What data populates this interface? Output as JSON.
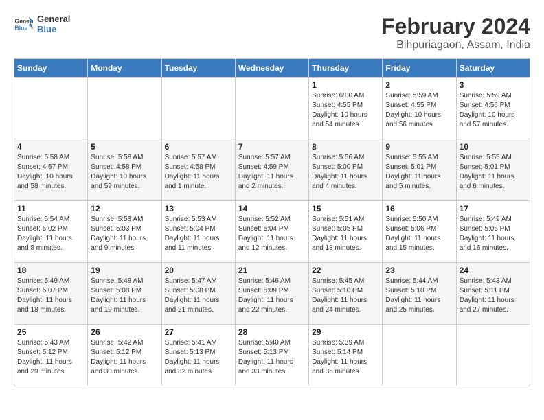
{
  "header": {
    "logo_line1": "General",
    "logo_line2": "Blue",
    "title": "February 2024",
    "subtitle": "Bihpuriagaon, Assam, India"
  },
  "days_of_week": [
    "Sunday",
    "Monday",
    "Tuesday",
    "Wednesday",
    "Thursday",
    "Friday",
    "Saturday"
  ],
  "weeks": [
    [
      {
        "day": "",
        "sunrise": "",
        "sunset": "",
        "daylight": ""
      },
      {
        "day": "",
        "sunrise": "",
        "sunset": "",
        "daylight": ""
      },
      {
        "day": "",
        "sunrise": "",
        "sunset": "",
        "daylight": ""
      },
      {
        "day": "",
        "sunrise": "",
        "sunset": "",
        "daylight": ""
      },
      {
        "day": "1",
        "sunrise": "Sunrise: 6:00 AM",
        "sunset": "Sunset: 4:55 PM",
        "daylight": "Daylight: 10 hours and 54 minutes."
      },
      {
        "day": "2",
        "sunrise": "Sunrise: 5:59 AM",
        "sunset": "Sunset: 4:55 PM",
        "daylight": "Daylight: 10 hours and 56 minutes."
      },
      {
        "day": "3",
        "sunrise": "Sunrise: 5:59 AM",
        "sunset": "Sunset: 4:56 PM",
        "daylight": "Daylight: 10 hours and 57 minutes."
      }
    ],
    [
      {
        "day": "4",
        "sunrise": "Sunrise: 5:58 AM",
        "sunset": "Sunset: 4:57 PM",
        "daylight": "Daylight: 10 hours and 58 minutes."
      },
      {
        "day": "5",
        "sunrise": "Sunrise: 5:58 AM",
        "sunset": "Sunset: 4:58 PM",
        "daylight": "Daylight: 10 hours and 59 minutes."
      },
      {
        "day": "6",
        "sunrise": "Sunrise: 5:57 AM",
        "sunset": "Sunset: 4:58 PM",
        "daylight": "Daylight: 11 hours and 1 minute."
      },
      {
        "day": "7",
        "sunrise": "Sunrise: 5:57 AM",
        "sunset": "Sunset: 4:59 PM",
        "daylight": "Daylight: 11 hours and 2 minutes."
      },
      {
        "day": "8",
        "sunrise": "Sunrise: 5:56 AM",
        "sunset": "Sunset: 5:00 PM",
        "daylight": "Daylight: 11 hours and 4 minutes."
      },
      {
        "day": "9",
        "sunrise": "Sunrise: 5:55 AM",
        "sunset": "Sunset: 5:01 PM",
        "daylight": "Daylight: 11 hours and 5 minutes."
      },
      {
        "day": "10",
        "sunrise": "Sunrise: 5:55 AM",
        "sunset": "Sunset: 5:01 PM",
        "daylight": "Daylight: 11 hours and 6 minutes."
      }
    ],
    [
      {
        "day": "11",
        "sunrise": "Sunrise: 5:54 AM",
        "sunset": "Sunset: 5:02 PM",
        "daylight": "Daylight: 11 hours and 8 minutes."
      },
      {
        "day": "12",
        "sunrise": "Sunrise: 5:53 AM",
        "sunset": "Sunset: 5:03 PM",
        "daylight": "Daylight: 11 hours and 9 minutes."
      },
      {
        "day": "13",
        "sunrise": "Sunrise: 5:53 AM",
        "sunset": "Sunset: 5:04 PM",
        "daylight": "Daylight: 11 hours and 11 minutes."
      },
      {
        "day": "14",
        "sunrise": "Sunrise: 5:52 AM",
        "sunset": "Sunset: 5:04 PM",
        "daylight": "Daylight: 11 hours and 12 minutes."
      },
      {
        "day": "15",
        "sunrise": "Sunrise: 5:51 AM",
        "sunset": "Sunset: 5:05 PM",
        "daylight": "Daylight: 11 hours and 13 minutes."
      },
      {
        "day": "16",
        "sunrise": "Sunrise: 5:50 AM",
        "sunset": "Sunset: 5:06 PM",
        "daylight": "Daylight: 11 hours and 15 minutes."
      },
      {
        "day": "17",
        "sunrise": "Sunrise: 5:49 AM",
        "sunset": "Sunset: 5:06 PM",
        "daylight": "Daylight: 11 hours and 16 minutes."
      }
    ],
    [
      {
        "day": "18",
        "sunrise": "Sunrise: 5:49 AM",
        "sunset": "Sunset: 5:07 PM",
        "daylight": "Daylight: 11 hours and 18 minutes."
      },
      {
        "day": "19",
        "sunrise": "Sunrise: 5:48 AM",
        "sunset": "Sunset: 5:08 PM",
        "daylight": "Daylight: 11 hours and 19 minutes."
      },
      {
        "day": "20",
        "sunrise": "Sunrise: 5:47 AM",
        "sunset": "Sunset: 5:08 PM",
        "daylight": "Daylight: 11 hours and 21 minutes."
      },
      {
        "day": "21",
        "sunrise": "Sunrise: 5:46 AM",
        "sunset": "Sunset: 5:09 PM",
        "daylight": "Daylight: 11 hours and 22 minutes."
      },
      {
        "day": "22",
        "sunrise": "Sunrise: 5:45 AM",
        "sunset": "Sunset: 5:10 PM",
        "daylight": "Daylight: 11 hours and 24 minutes."
      },
      {
        "day": "23",
        "sunrise": "Sunrise: 5:44 AM",
        "sunset": "Sunset: 5:10 PM",
        "daylight": "Daylight: 11 hours and 25 minutes."
      },
      {
        "day": "24",
        "sunrise": "Sunrise: 5:43 AM",
        "sunset": "Sunset: 5:11 PM",
        "daylight": "Daylight: 11 hours and 27 minutes."
      }
    ],
    [
      {
        "day": "25",
        "sunrise": "Sunrise: 5:43 AM",
        "sunset": "Sunset: 5:12 PM",
        "daylight": "Daylight: 11 hours and 29 minutes."
      },
      {
        "day": "26",
        "sunrise": "Sunrise: 5:42 AM",
        "sunset": "Sunset: 5:12 PM",
        "daylight": "Daylight: 11 hours and 30 minutes."
      },
      {
        "day": "27",
        "sunrise": "Sunrise: 5:41 AM",
        "sunset": "Sunset: 5:13 PM",
        "daylight": "Daylight: 11 hours and 32 minutes."
      },
      {
        "day": "28",
        "sunrise": "Sunrise: 5:40 AM",
        "sunset": "Sunset: 5:13 PM",
        "daylight": "Daylight: 11 hours and 33 minutes."
      },
      {
        "day": "29",
        "sunrise": "Sunrise: 5:39 AM",
        "sunset": "Sunset: 5:14 PM",
        "daylight": "Daylight: 11 hours and 35 minutes."
      },
      {
        "day": "",
        "sunrise": "",
        "sunset": "",
        "daylight": ""
      },
      {
        "day": "",
        "sunrise": "",
        "sunset": "",
        "daylight": ""
      }
    ]
  ]
}
